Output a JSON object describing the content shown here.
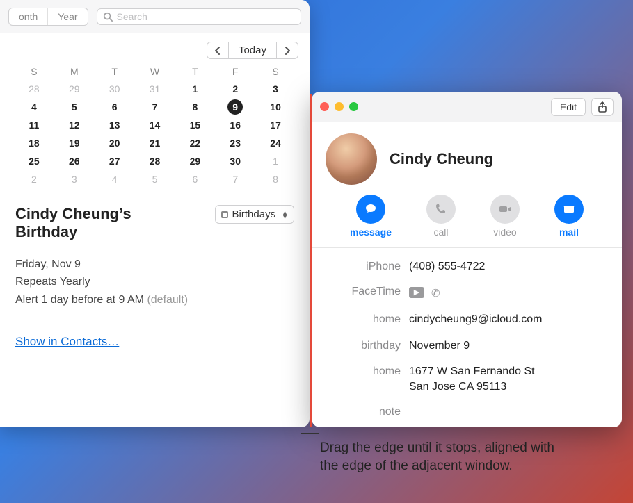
{
  "calendar": {
    "view_options": [
      "onth",
      "Year"
    ],
    "search_placeholder": "Search",
    "today_label": "Today",
    "dow": [
      "S",
      "M",
      "T",
      "W",
      "T",
      "F",
      "S"
    ],
    "weeks": [
      [
        {
          "d": "28",
          "o": true
        },
        {
          "d": "29",
          "o": true
        },
        {
          "d": "30",
          "o": true
        },
        {
          "d": "31",
          "o": true
        },
        {
          "d": "1"
        },
        {
          "d": "2"
        },
        {
          "d": "3"
        }
      ],
      [
        {
          "d": "4"
        },
        {
          "d": "5"
        },
        {
          "d": "6"
        },
        {
          "d": "7"
        },
        {
          "d": "8"
        },
        {
          "d": "9",
          "sel": true
        },
        {
          "d": "10"
        }
      ],
      [
        {
          "d": "11"
        },
        {
          "d": "12"
        },
        {
          "d": "13"
        },
        {
          "d": "14"
        },
        {
          "d": "15"
        },
        {
          "d": "16"
        },
        {
          "d": "17"
        }
      ],
      [
        {
          "d": "18"
        },
        {
          "d": "19"
        },
        {
          "d": "20"
        },
        {
          "d": "21"
        },
        {
          "d": "22"
        },
        {
          "d": "23"
        },
        {
          "d": "24"
        }
      ],
      [
        {
          "d": "25"
        },
        {
          "d": "26"
        },
        {
          "d": "27"
        },
        {
          "d": "28"
        },
        {
          "d": "29"
        },
        {
          "d": "30"
        },
        {
          "d": "1",
          "o": true
        }
      ],
      [
        {
          "d": "2",
          "o": true
        },
        {
          "d": "3",
          "o": true
        },
        {
          "d": "4",
          "o": true
        },
        {
          "d": "5",
          "o": true
        },
        {
          "d": "6",
          "o": true
        },
        {
          "d": "7",
          "o": true
        },
        {
          "d": "8",
          "o": true
        }
      ]
    ],
    "event": {
      "title": "Cindy Cheung’s Birthday",
      "calendar_name": "Birthdays",
      "date_line": "Friday, Nov 9",
      "repeat_line": "Repeats Yearly",
      "alert_line": "Alert 1 day before at 9 AM ",
      "alert_suffix": "(default)",
      "show_link": "Show in Contacts…"
    }
  },
  "contacts": {
    "edit_label": "Edit",
    "name": "Cindy Cheung",
    "actions": [
      {
        "key": "message",
        "label": "message",
        "active": true
      },
      {
        "key": "call",
        "label": "call",
        "active": false
      },
      {
        "key": "video",
        "label": "video",
        "active": false
      },
      {
        "key": "mail",
        "label": "mail",
        "active": true
      }
    ],
    "fields": [
      {
        "label": "iPhone",
        "value": "(408) 555-4722",
        "type": "text"
      },
      {
        "label": "FaceTime",
        "value": "",
        "type": "facetime"
      },
      {
        "label": "home",
        "value": "cindycheung9@icloud.com",
        "type": "text"
      },
      {
        "label": "birthday",
        "value": "November 9",
        "type": "text"
      },
      {
        "label": "home",
        "value": "1677 W San Fernando St\nSan Jose CA 95113",
        "type": "text"
      },
      {
        "label": "note",
        "value": "",
        "type": "text"
      }
    ]
  },
  "callout": "Drag the edge until it stops, aligned with the edge of the adjacent window."
}
